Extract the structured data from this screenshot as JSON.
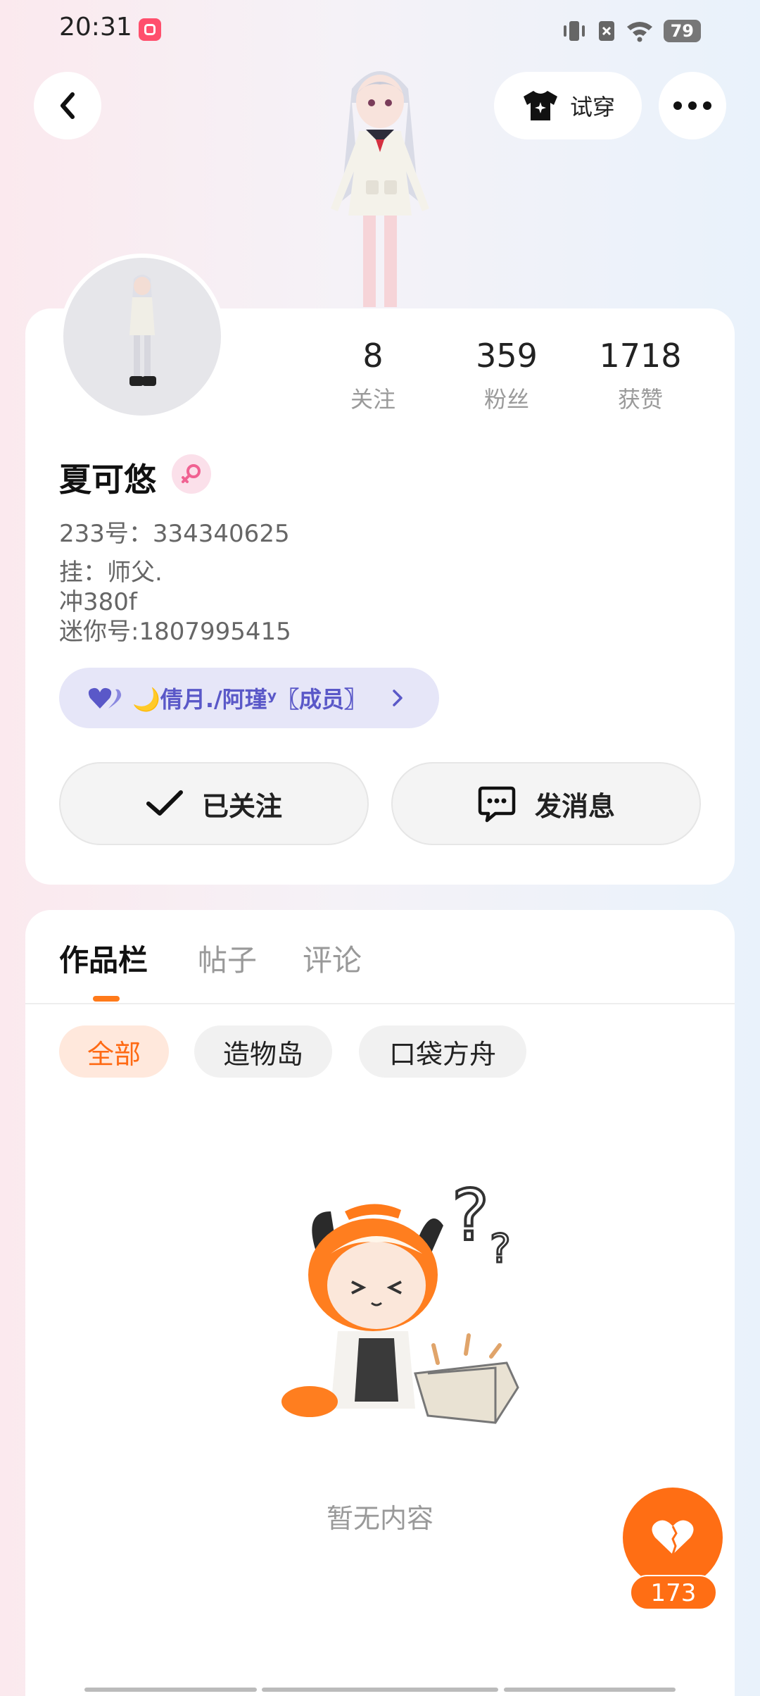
{
  "status_bar": {
    "time": "20:31",
    "battery": "79"
  },
  "header": {
    "try_on_label": "试穿"
  },
  "stats": [
    {
      "num": "8",
      "label": "关注"
    },
    {
      "num": "359",
      "label": "粉丝"
    },
    {
      "num": "1718",
      "label": "获赞"
    }
  ],
  "profile": {
    "name": "夏可悠",
    "uid": "233号：334340625",
    "bio": [
      "挂：师父.",
      "冲380f",
      "迷你号:1807995415"
    ],
    "group": "🌙倩月./阿瑾ʸ〖成员〗"
  },
  "actions": {
    "follow_label": "已关注",
    "message_label": "发消息"
  },
  "tabs": [
    "作品栏",
    "帖子",
    "评论"
  ],
  "chips": [
    "全部",
    "造物岛",
    "口袋方舟"
  ],
  "empty_text": "暂无内容",
  "fab": {
    "count": "173"
  },
  "colors": {
    "accent": "#ff6e14",
    "group_text": "#5a58c8"
  }
}
